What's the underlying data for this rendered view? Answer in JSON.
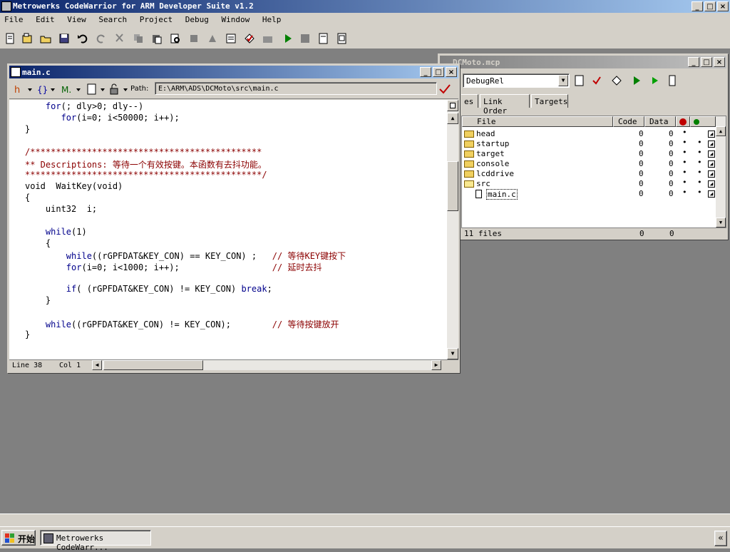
{
  "app": {
    "title": "Metrowerks CodeWarrior for ARM Developer Suite v1.2",
    "min": "_",
    "max": "□",
    "close": "×"
  },
  "menu": [
    "File",
    "Edit",
    "View",
    "Search",
    "Project",
    "Debug",
    "Window",
    "Help"
  ],
  "editor": {
    "title": "main.c",
    "path_label": "Path:",
    "path": "E:\\ARM\\ADS\\DCMoto\\src\\main.c",
    "status_line": "Line 38",
    "status_col": "Col 1",
    "code_lines": [
      {
        "text": "    for(; dly>0; dly--)",
        "cls": "kw"
      },
      {
        "text": "       for(i=0; i<50000; i++);",
        "cls": "kw"
      },
      {
        "text": "}",
        "cls": ""
      },
      {
        "text": "",
        "cls": ""
      },
      {
        "text": "/*********************************************",
        "cls": "cm"
      },
      {
        "text": "** Descriptions: 等待一个有效按键。本函数有去抖功能。",
        "cls": "cm"
      },
      {
        "text": "**********************************************/",
        "cls": "cm"
      },
      {
        "text": "void  WaitKey(void)",
        "cls": ""
      },
      {
        "text": "{",
        "cls": ""
      },
      {
        "text": "    uint32  i;",
        "cls": ""
      },
      {
        "text": "",
        "cls": ""
      },
      {
        "text": "    while(1)",
        "cls": "kw"
      },
      {
        "text": "    {",
        "cls": ""
      },
      {
        "text": "        while((rGPFDAT&KEY_CON) == KEY_CON) ;   // 等待KEY键按下",
        "cls": "mix1"
      },
      {
        "text": "        for(i=0; i<1000; i++);                  // 延时去抖",
        "cls": "mix2"
      },
      {
        "text": "",
        "cls": ""
      },
      {
        "text": "        if( (rGPFDAT&KEY_CON) != KEY_CON) break;",
        "cls": "mix3"
      },
      {
        "text": "    }",
        "cls": ""
      },
      {
        "text": "",
        "cls": ""
      },
      {
        "text": "    while((rGPFDAT&KEY_CON) != KEY_CON);        // 等待按键放开",
        "cls": "mix4"
      },
      {
        "text": "}",
        "cls": ""
      }
    ]
  },
  "project": {
    "title": "DCMoto.mcp",
    "target": "DebugRel",
    "tabs": [
      "es",
      "Link Order",
      "Targets"
    ],
    "columns": {
      "file": "File",
      "code": "Code",
      "data": "Data"
    },
    "files": [
      {
        "name": "head",
        "code": "0",
        "data": "0",
        "dot1": "•",
        "dot2": "",
        "type": "folder"
      },
      {
        "name": "startup",
        "code": "0",
        "data": "0",
        "dot1": "•",
        "dot2": "•",
        "type": "folder"
      },
      {
        "name": "target",
        "code": "0",
        "data": "0",
        "dot1": "•",
        "dot2": "•",
        "type": "folder"
      },
      {
        "name": "console",
        "code": "0",
        "data": "0",
        "dot1": "•",
        "dot2": "•",
        "type": "folder"
      },
      {
        "name": "lcddrive",
        "code": "0",
        "data": "0",
        "dot1": "•",
        "dot2": "•",
        "type": "folder"
      },
      {
        "name": "src",
        "code": "0",
        "data": "0",
        "dot1": "•",
        "dot2": "•",
        "type": "folder-open"
      },
      {
        "name": "main.c",
        "code": "0",
        "data": "0",
        "dot1": "•",
        "dot2": "•",
        "type": "file"
      }
    ],
    "summary": "11 files",
    "total_code": "0",
    "total_data": "0"
  },
  "taskbar": {
    "start": "开始",
    "task": "Metrowerks CodeWarr...",
    "tray": "«"
  }
}
